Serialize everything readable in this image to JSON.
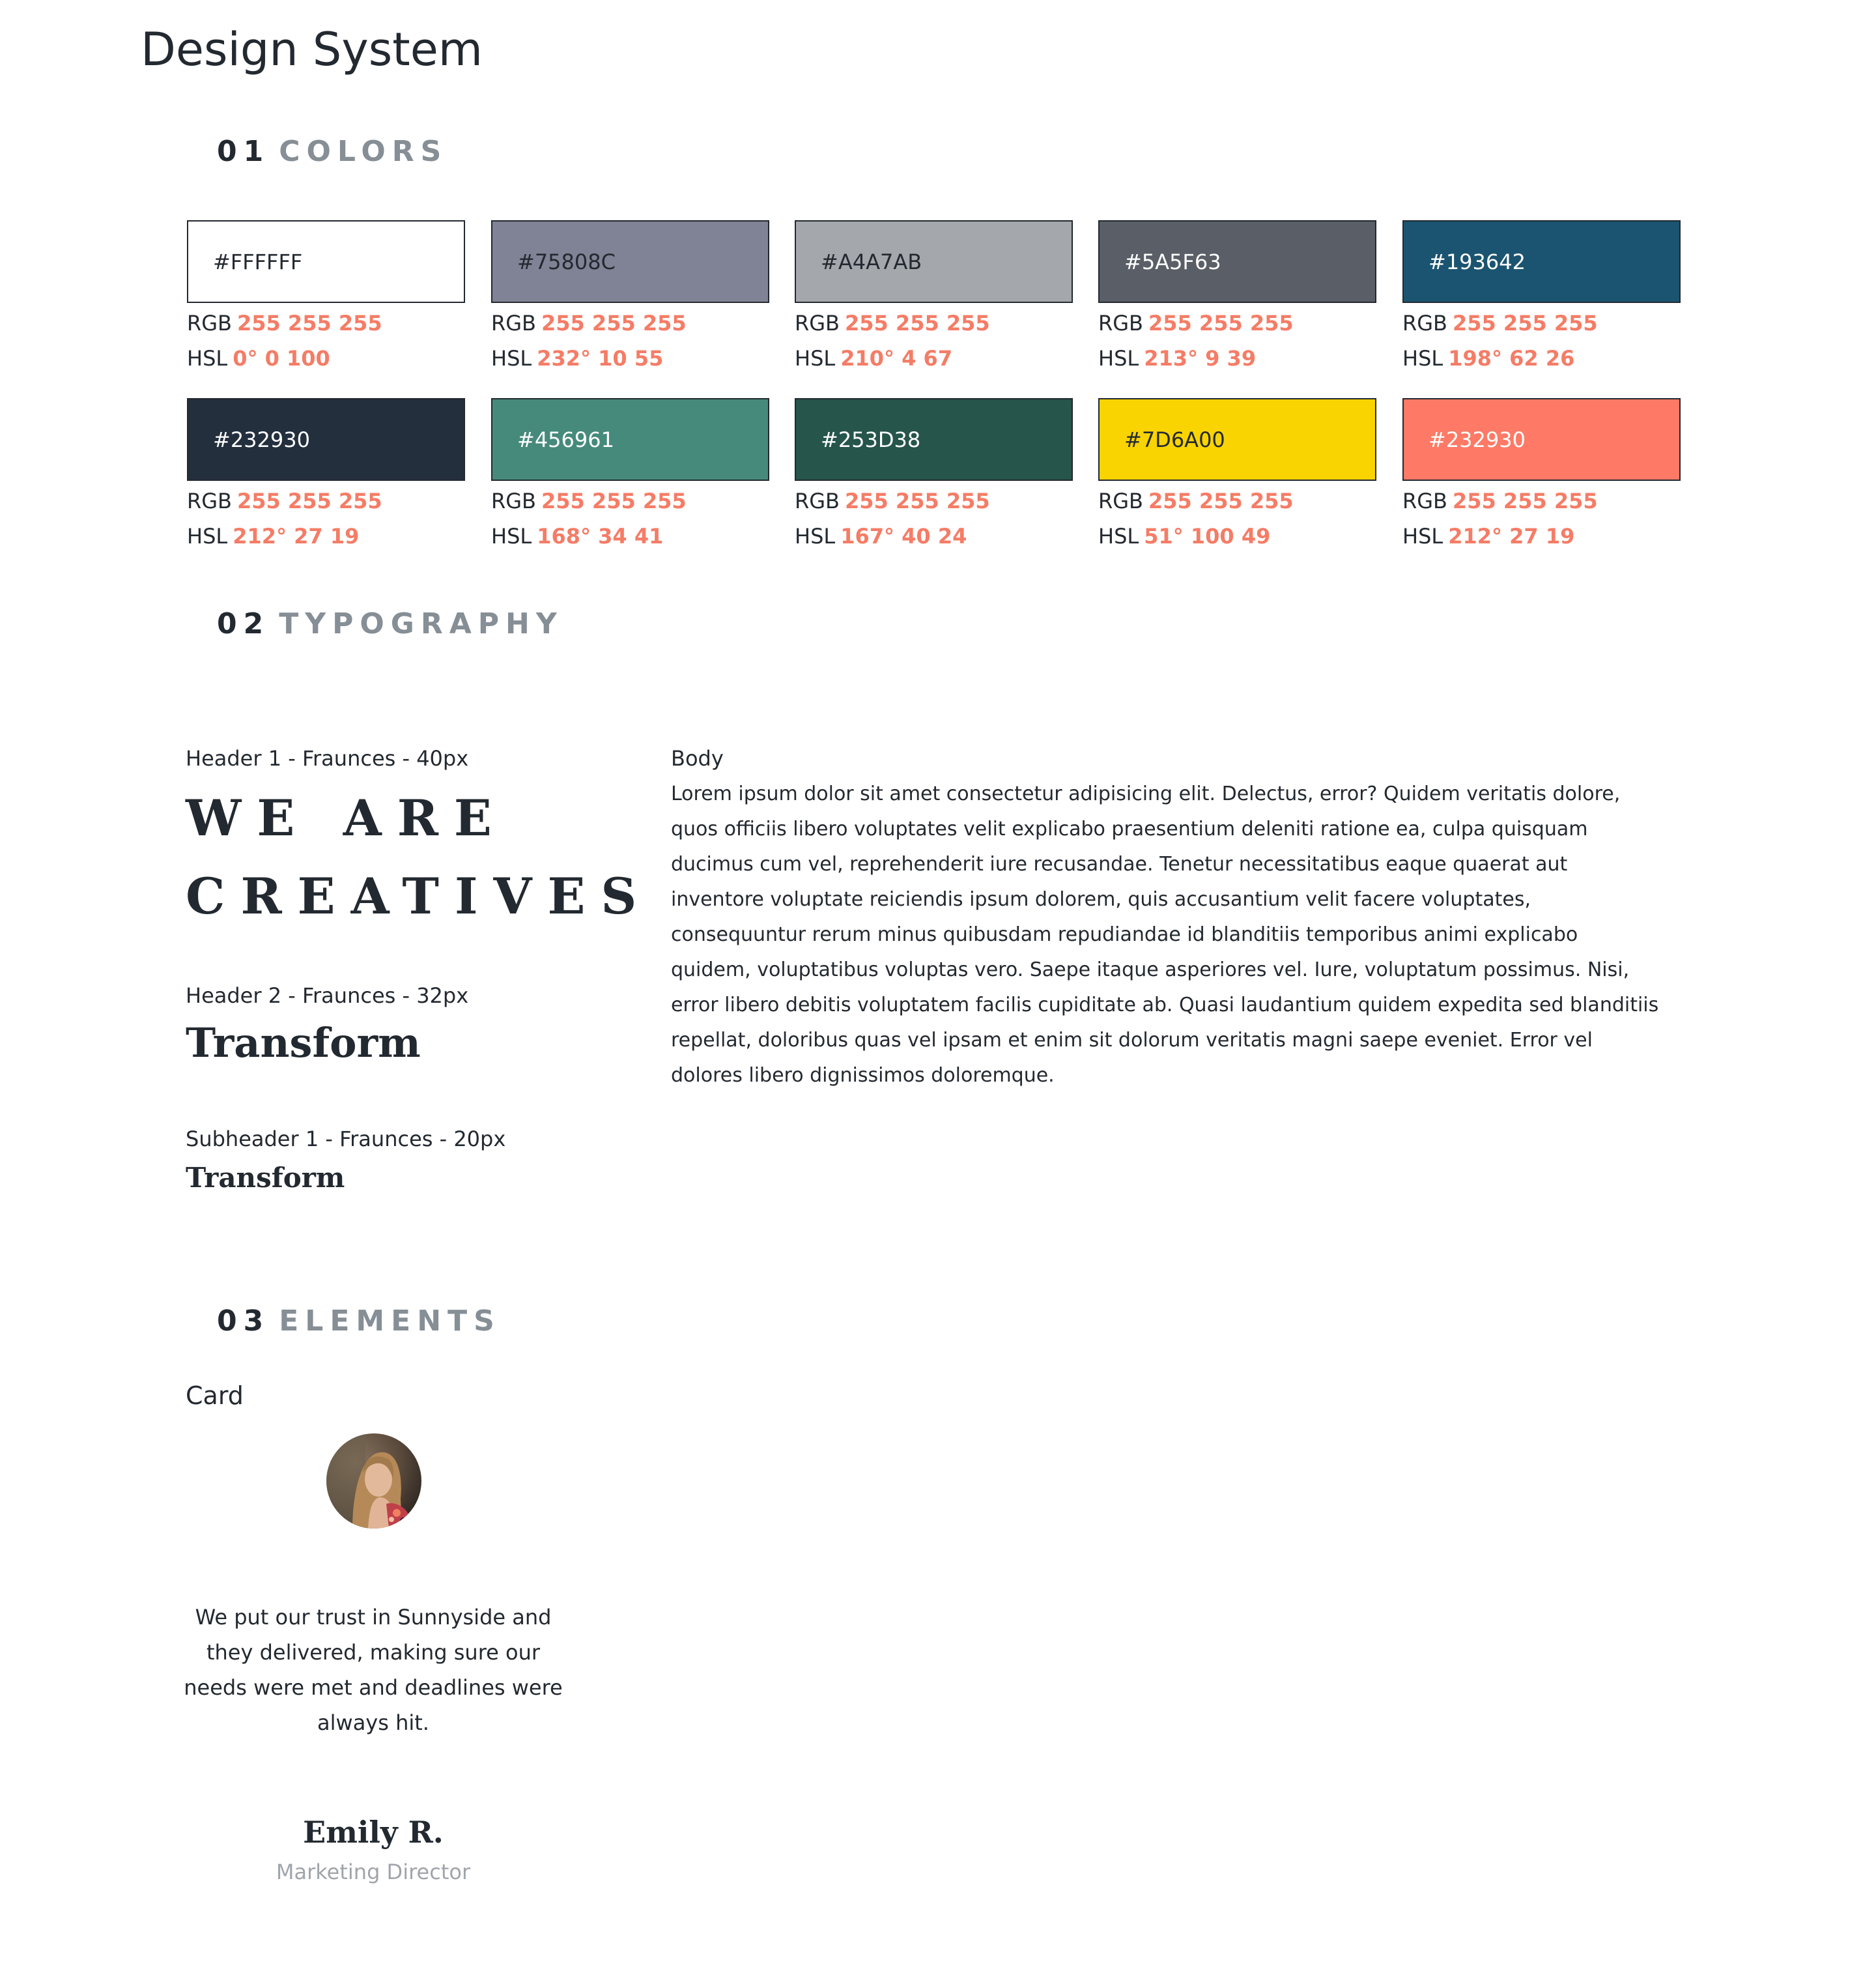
{
  "page": {
    "title": "Design System"
  },
  "sections": {
    "colors": {
      "number": "01",
      "name": "COLORS"
    },
    "typography": {
      "number": "02",
      "name": "TYPOGRAPHY"
    },
    "elements": {
      "number": "03",
      "name": "ELEMENTS"
    }
  },
  "swatch_labels": {
    "rgb": "RGB",
    "hsl": "HSL"
  },
  "swatches": [
    {
      "hex": "#FFFFFF",
      "fill": "#ffffff",
      "text": "#232930",
      "rgb": "255 255 255",
      "hsl": "0° 0 100"
    },
    {
      "hex": "#75808C",
      "fill": "#808295",
      "text": "#232930",
      "rgb": "255 255 255",
      "hsl": "232° 10 55"
    },
    {
      "hex": "#A4A7AB",
      "fill": "#a4a7ab",
      "text": "#232930",
      "rgb": "255 255 255",
      "hsl": "210° 4 67"
    },
    {
      "hex": "#5A5F63",
      "fill": "#5a5f67",
      "text": "#ffffff",
      "rgb": "255 255 255",
      "hsl": "213° 9 39"
    },
    {
      "hex": "#193642",
      "fill": "#1b5470",
      "text": "#ffffff",
      "rgb": "255 255 255",
      "hsl": "198° 62 26"
    },
    {
      "hex": "#232930",
      "fill": "#232f3d",
      "text": "#ffffff",
      "rgb": "255 255 255",
      "hsl": "212° 27 19"
    },
    {
      "hex": "#456961",
      "fill": "#468a7c",
      "text": "#ffffff",
      "rgb": "255 255 255",
      "hsl": "168° 34 41"
    },
    {
      "hex": "#253D38",
      "fill": "#25554b",
      "text": "#ffffff",
      "rgb": "255 255 255",
      "hsl": "167° 40 24"
    },
    {
      "hex": "#7D6A00",
      "fill": "#fad400",
      "text": "#232930",
      "rgb": "255 255 255",
      "hsl": "51° 100 49"
    },
    {
      "hex": "#232930",
      "fill": "#fe7a66",
      "text": "#ffffff",
      "rgb": "255 255 255",
      "hsl": "212° 27 19"
    }
  ],
  "typography": {
    "h1_label": "Header 1 - Fraunces - 40px",
    "h1_line1": "WE ARE",
    "h1_line2": "CREATIVES",
    "h2_label": "Header 2 - Fraunces - 32px",
    "h2_sample": "Transform",
    "sub_label": "Subheader 1 - Fraunces - 20px",
    "sub_sample": "Transform",
    "body_label": "Body",
    "body_text": "Lorem ipsum dolor sit amet consectetur adipisicing elit. Delectus, error? Quidem veritatis dolore, quos officiis libero voluptates velit explicabo praesentium deleniti ratione ea, culpa quisquam ducimus cum vel, reprehenderit iure recusandae. Tenetur necessitatibus eaque quaerat aut inventore voluptate reiciendis ipsum dolorem, quis accusantium velit facere voluptates, consequuntur rerum minus quibusdam repudiandae id blanditiis temporibus animi explicabo quidem, voluptatibus voluptas vero. Saepe itaque asperiores vel. Iure, voluptatum possimus. Nisi, error libero debitis voluptatem facilis cupiditate ab. Quasi laudantium quidem expedita sed blanditiis repellat, doloribus quas vel ipsam et enim sit dolorum veritatis magni saepe eveniet. Error vel dolores libero dignissimos doloremque."
  },
  "elements": {
    "card_label": "Card",
    "card": {
      "quote": "We put our trust in Sunnyside and they delivered, making sure our needs were met and deadlines were always hit.",
      "name": "Emily R.",
      "role": "Marketing Director"
    }
  }
}
